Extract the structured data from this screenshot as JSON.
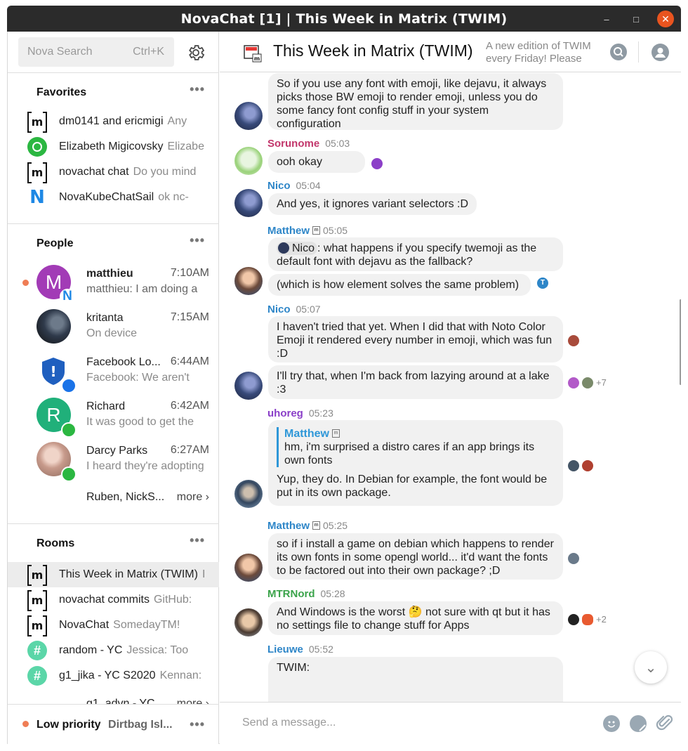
{
  "window": {
    "title": "NovaChat [1] | This Week in Matrix (TWIM)"
  },
  "sidebar": {
    "search": {
      "placeholder": "Nova Search",
      "shortcut": "Ctrl+K"
    },
    "favorites": {
      "title": "Favorites",
      "items": [
        {
          "name": "dm0141 and ericmigi",
          "preview": "Any",
          "icon": "matrix-icon"
        },
        {
          "name": "Elizabeth Migicovsky",
          "preview": "Elizabe",
          "icon": "whatsapp-icon"
        },
        {
          "name": "novachat chat",
          "preview": "Do you mind",
          "icon": "matrix-icon"
        },
        {
          "name": "NovaKubeChatSail",
          "preview": "ok nc-",
          "icon": "novakube-icon"
        }
      ]
    },
    "people": {
      "title": "People",
      "items": [
        {
          "name": "matthieu",
          "time": "7:10AM",
          "preview": "matthieu: I am doing a",
          "avatar_letter": "M",
          "avatar_color": "#a23bb6",
          "unread": true
        },
        {
          "name": "kritanta",
          "time": "7:15AM",
          "preview": "On device",
          "avatar_color": "#2f3a4b"
        },
        {
          "name": "Facebook Lo...",
          "time": "6:44AM",
          "preview": "Facebook: We aren't",
          "avatar_color": "#1f5fbf"
        },
        {
          "name": "Richard",
          "time": "6:42AM",
          "preview": "It was good to get the",
          "avatar_letter": "R",
          "avatar_color": "#20b07a"
        },
        {
          "name": "Darcy Parks",
          "time": "6:27AM",
          "preview": "I heard they're adopting",
          "avatar_color": "#c79a8b"
        }
      ],
      "more_names": "Ruben, NickS...",
      "more_label": "more ›"
    },
    "rooms": {
      "title": "Rooms",
      "items": [
        {
          "name": "This Week in Matrix (TWIM)",
          "preview": "I",
          "icon": "matrix-icon",
          "active": true
        },
        {
          "name": "novachat commits",
          "preview": "GitHub:",
          "icon": "matrix-icon"
        },
        {
          "name": "NovaChat",
          "preview": "SomedayTM!",
          "icon": "matrix-icon"
        },
        {
          "name": "random - YC",
          "preview": "Jessica: Too",
          "icon": "slack-icon"
        },
        {
          "name": "g1_jika - YC S2020",
          "preview": "Kennan:",
          "icon": "slack-icon"
        }
      ],
      "partial_row": "g1_advn - YC",
      "more_label": "more ›"
    },
    "low_priority": {
      "title": "Low priority",
      "preview": "Dirtbag Isl..."
    }
  },
  "header": {
    "room_title": "This Week in Matrix (TWIM)",
    "topic": "A new edition of TWIM every Friday! Please"
  },
  "messages": [
    {
      "sender": "",
      "time": "",
      "text": "So if you use any font with emoji, like dejavu, it always picks those BW emoji to render emoji, unless you do some fancy font config stuff in your system configuration"
    },
    {
      "sender": "Sorunome",
      "time": "05:03",
      "color": "#c2366b",
      "text": "ooh okay"
    },
    {
      "sender": "Nico",
      "time": "05:04",
      "color": "#2e86c8",
      "text": "And yes, it ignores variant selectors :D"
    },
    {
      "sender": "Matthew",
      "time": "05:05",
      "color": "#2e86c8",
      "mention": "Nico",
      "text": ": what happens if you specify twemoji as the default font with dejavu as the fallback?",
      "text2": "(which is how element solves the same problem)",
      "receipt": "T"
    },
    {
      "sender": "Nico",
      "time": "05:07",
      "color": "#2e86c8",
      "text": "I haven't tried that yet. When I did that with Noto Color Emoji it rendered every number in emoji, which was fun :D",
      "text2": "I'll try that, when I'm back from lazying around at a lake :3",
      "more_readers": "+7"
    },
    {
      "sender": "uhoreg",
      "time": "05:23",
      "color": "#8a3fc8",
      "quote_name": "Matthew",
      "quote_text": "hm, i'm surprised a distro cares if an app brings its own fonts",
      "text": "Yup, they do. In Debian for example, the font would be put in its own package."
    },
    {
      "sender": "Matthew",
      "time": "05:25",
      "color": "#2e86c8",
      "text": "so if i install a game on debian which happens to render its own fonts in some opengl world... it'd want the fonts to be factored out into their own package? ;D"
    },
    {
      "sender": "MTRNord",
      "time": "05:28",
      "color": "#3aa34a",
      "text": "And Windows is the worst 🤔 not sure with qt but it has no settings file to change stuff for Apps",
      "more_readers": "+2"
    },
    {
      "sender": "Lieuwe",
      "time": "05:52",
      "color": "#2e86c8",
      "text": "TWIM:"
    }
  ],
  "composer": {
    "placeholder": "Send a message..."
  },
  "colors": {
    "accent": "#2e86c8",
    "unread": "#ef7d55",
    "close_button": "#e9541f"
  }
}
